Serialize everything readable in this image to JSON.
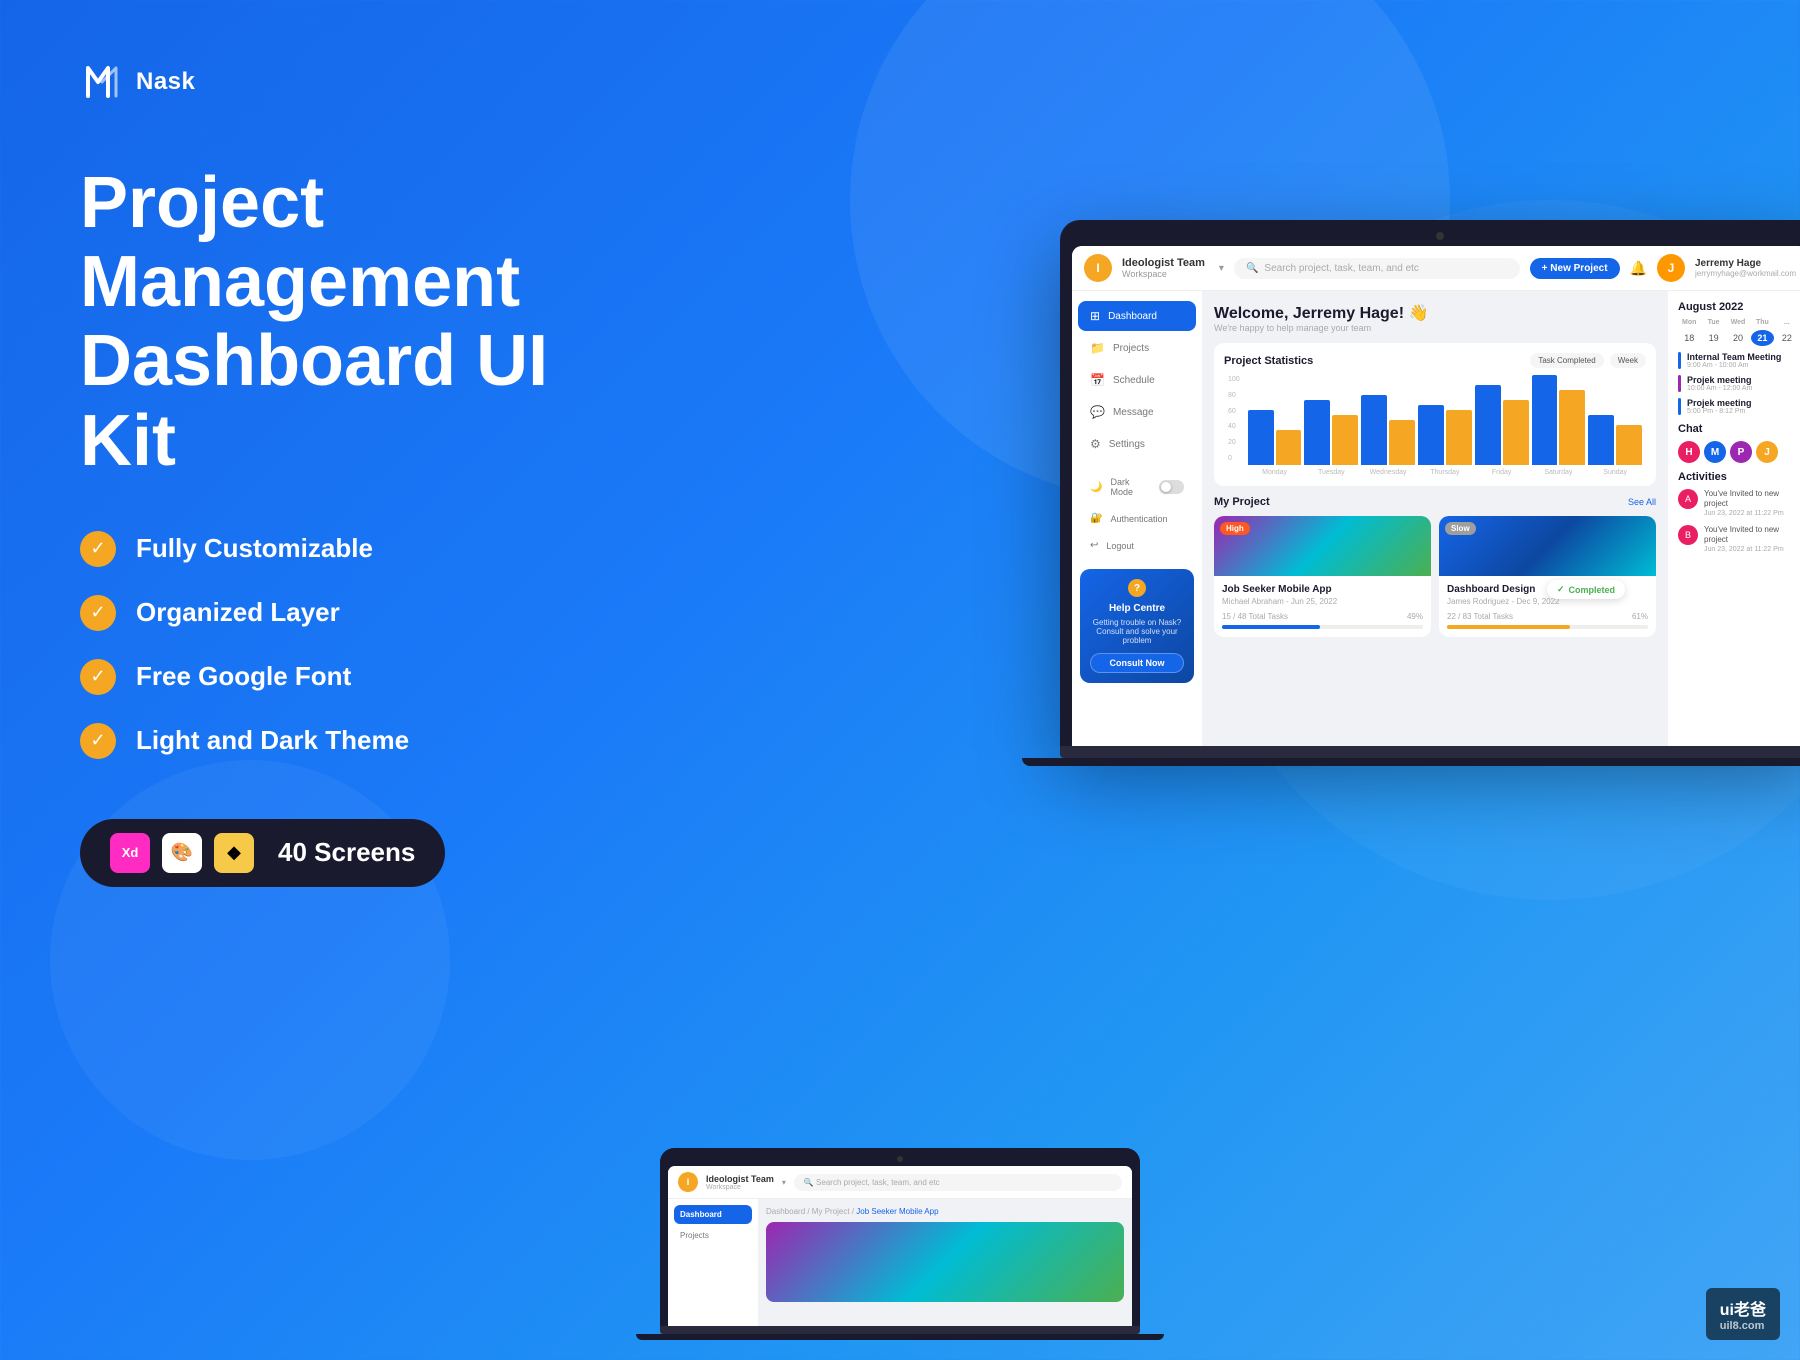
{
  "brand": {
    "logo_text": "Nask",
    "tagline": "Project Management Dashboard UI Kit"
  },
  "headline_line1": "Project Management",
  "headline_line2": "Dashboard UI Kit",
  "features": [
    {
      "label": "Fully Customizable"
    },
    {
      "label": "Organized Layer"
    },
    {
      "label": "Free Google Font"
    },
    {
      "label": "Light and Dark Theme"
    }
  ],
  "tools_badge": {
    "screens_label": "40 Screens",
    "tool_xd": "Xd",
    "tool_figma": "🎨",
    "tool_sketch": "◆"
  },
  "dashboard": {
    "workspace_name": "Ideologist Team",
    "workspace_sub": "Workspace",
    "search_placeholder": "Search project, task, team, and etc",
    "new_project_btn": "+ New Project",
    "user_name": "Jerremy Hage",
    "user_email": "jerrymyhage@workmail.com",
    "welcome_title": "Welcome, Jerremy Hage! 👋",
    "welcome_sub": "We're happy to help manage your team",
    "nav": [
      {
        "icon": "⊞",
        "label": "Dashboard",
        "active": true
      },
      {
        "icon": "📁",
        "label": "Projects",
        "active": false
      },
      {
        "icon": "📅",
        "label": "Schedule",
        "active": false
      },
      {
        "icon": "💬",
        "label": "Message",
        "active": false
      },
      {
        "icon": "⚙",
        "label": "Settings",
        "active": false
      }
    ],
    "dark_mode_label": "Dark Mode",
    "auth_label": "Authentication",
    "logout_label": "Logout",
    "stats": {
      "title": "Project Statistics",
      "filter1": "Task Completed",
      "filter2": "Week",
      "y_labels": [
        "100",
        "80",
        "60",
        "40",
        "20",
        "0"
      ],
      "x_labels": [
        "Monday",
        "Tuesday",
        "Wednesday",
        "Thursday",
        "Friday",
        "Saturday",
        "Sunday"
      ],
      "bars": [
        {
          "blue": 55,
          "orange": 35
        },
        {
          "blue": 65,
          "orange": 50
        },
        {
          "blue": 70,
          "orange": 45
        },
        {
          "blue": 60,
          "orange": 55
        },
        {
          "blue": 80,
          "orange": 65
        },
        {
          "blue": 90,
          "orange": 75
        },
        {
          "blue": 50,
          "orange": 40
        }
      ]
    },
    "projects": {
      "title": "My Project",
      "see_all": "See All",
      "cards": [
        {
          "badge": "High",
          "badge_type": "high",
          "title": "Job Seeker Mobile App",
          "date": "Michael Abraham - Jun 25, 2022",
          "tasks": "15 / 48 Total Tasks",
          "progress": 49,
          "progress_type": "blue"
        },
        {
          "badge": "Slow",
          "badge_type": "slow",
          "title": "Dashboard Design",
          "date": "James Rodriguez - Dec 9, 2022",
          "tasks": "22 / 83 Total Tasks",
          "progress": 61,
          "progress_type": "orange"
        }
      ]
    },
    "help": {
      "title": "Help Centre",
      "desc": "Getting trouble on Nask? Consult and solve your problem",
      "btn": "Consult Now"
    },
    "calendar": {
      "month": "August 2022",
      "day_labels": [
        "Mon",
        "Tue",
        "Wed",
        "Thu"
      ],
      "days": [
        "18",
        "19",
        "20",
        "21",
        "22"
      ],
      "active_day": "21"
    },
    "meetings": [
      {
        "title": "Internal Team Meeting",
        "time": "9:00 Am - 10:00 Am",
        "color": "blue"
      },
      {
        "title": "Projek meeting",
        "time": "10:00 Am - 12:00 Am",
        "color": "purple"
      },
      {
        "title": "Projek meeting",
        "time": "5:00 Pm - 8:12 Pm",
        "color": "blue"
      }
    ],
    "chat_label": "Chat",
    "chat_users": [
      "H",
      "M",
      "P",
      "J"
    ],
    "activities_label": "Activities",
    "activities": [
      {
        "text": "You've Invited to new project",
        "time": "Jun 23, 2022 at 11:22 Pm"
      },
      {
        "text": "You've Invited to new project",
        "time": "Jun 23, 2022 at 11:22 Pm"
      }
    ]
  },
  "bottom_dashboard": {
    "workspace_name": "Ideologist Team",
    "workspace_sub": "Workspace",
    "search_placeholder": "Search project, task, team, and etc",
    "nav_dashboard": "Dashboard",
    "breadcrumb": "Dashboard / My Project / Job Seeker Mobile App",
    "completed_label": "Completed"
  },
  "watermark": {
    "line1": "ui老爸",
    "line2": "uil8.com"
  }
}
